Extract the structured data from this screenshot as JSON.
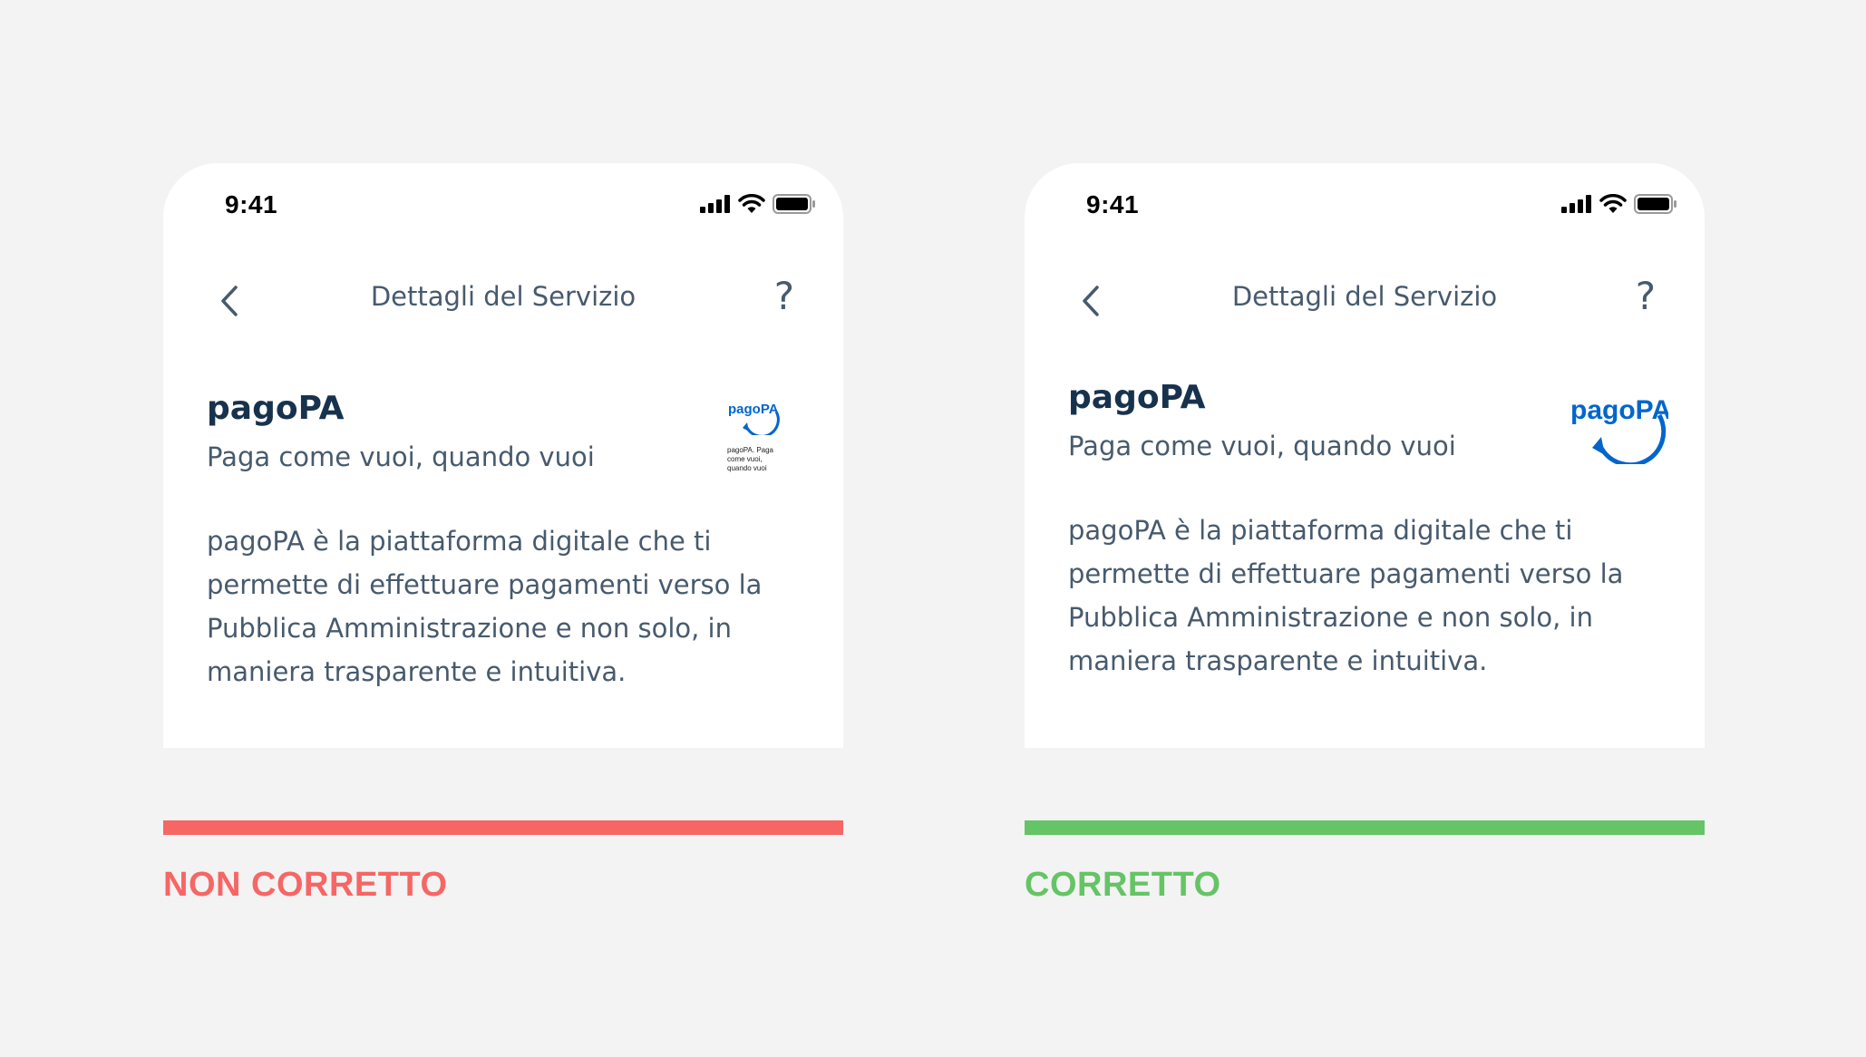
{
  "colors": {
    "background": "#f3f3f3",
    "phone": "#ffffff",
    "heading": "#17324d",
    "body_text": "#475a6d",
    "brand_blue": "#0066cc",
    "incorrect": "#f66665",
    "correct": "#65c466"
  },
  "panels": [
    {
      "status_bar": {
        "time": "9:41",
        "icons": [
          "cellular-signal-icon",
          "wifi-icon",
          "battery-icon"
        ]
      },
      "navigation": {
        "back_icon": "chevron-left-icon",
        "title": "Dettagli del Servizio",
        "help_icon": "question-mark-icon"
      },
      "service": {
        "name": "pagoPA",
        "tagline": "Paga come vuoi, quando vuoi",
        "description": "pagoPA è la piattaforma digitale che ti permette di effettuare pagamenti verso la Pubblica Amministrazione e non solo, in maniera trasparente e intuitiva.",
        "logo": {
          "text": "pagoPA",
          "caption": "pagoPA. Paga come vuoi, quando vuoi",
          "variant": "small-with-caption"
        }
      },
      "verdict": {
        "label": "NON CORRETTO",
        "color": "#f66665"
      }
    },
    {
      "status_bar": {
        "time": "9:41",
        "icons": [
          "cellular-signal-icon",
          "wifi-icon",
          "battery-icon"
        ]
      },
      "navigation": {
        "back_icon": "chevron-left-icon",
        "title": "Dettagli del Servizio",
        "help_icon": "question-mark-icon"
      },
      "service": {
        "name": "pagoPA",
        "tagline": "Paga come vuoi, quando vuoi",
        "description": "pagoPA è la piattaforma digitale che ti permette di effettuare pagamenti verso la Pubblica Amministrazione e non solo, in maniera trasparente e intuitiva.",
        "logo": {
          "text": "pagoPA",
          "variant": "large"
        }
      },
      "verdict": {
        "label": "CORRETTO",
        "color": "#65c466"
      }
    }
  ]
}
